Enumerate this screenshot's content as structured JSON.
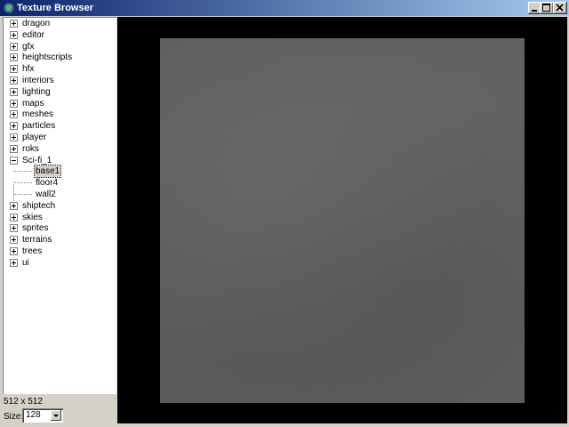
{
  "window": {
    "title": "Texture Browser",
    "icon": "app-globe-icon"
  },
  "title_buttons": [
    "minimize-icon",
    "maximize-icon",
    "close-icon"
  ],
  "tree": {
    "top_items": [
      {
        "label": "dragon",
        "expanded": false
      },
      {
        "label": "editor",
        "expanded": false
      },
      {
        "label": "gfx",
        "expanded": false
      },
      {
        "label": "heightscripts",
        "expanded": false
      },
      {
        "label": "hfx",
        "expanded": false
      },
      {
        "label": "interiors",
        "expanded": false
      },
      {
        "label": "lighting",
        "expanded": false
      },
      {
        "label": "maps",
        "expanded": false
      },
      {
        "label": "meshes",
        "expanded": false
      },
      {
        "label": "particles",
        "expanded": false
      },
      {
        "label": "player",
        "expanded": false
      },
      {
        "label": "roks",
        "expanded": false
      },
      {
        "label": "Sci-fi_1",
        "expanded": true
      }
    ],
    "children": [
      {
        "label": "base1",
        "selected": true
      },
      {
        "label": "floor4",
        "selected": false
      },
      {
        "label": "wall2",
        "selected": false
      }
    ],
    "bottom_items": [
      {
        "label": "shiptech",
        "expanded": false
      },
      {
        "label": "skies",
        "expanded": false
      },
      {
        "label": "sprites",
        "expanded": false
      },
      {
        "label": "terrains",
        "expanded": false
      },
      {
        "label": "trees",
        "expanded": false
      },
      {
        "label": "ui",
        "expanded": false
      }
    ]
  },
  "status": {
    "dimensions": "512 x 512",
    "size_label": "Size:",
    "size_value": "128"
  },
  "colors": {
    "titlebar_start": "#0a246a",
    "titlebar_end": "#a6caf0",
    "preview_background": "#000000",
    "texture_gray": "#5f5f5f"
  }
}
